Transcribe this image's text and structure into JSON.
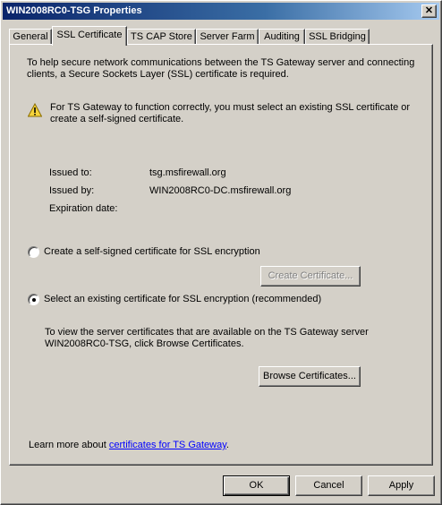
{
  "window": {
    "title": "WIN2008RC0-TSG Properties"
  },
  "tabs": [
    {
      "label": "General"
    },
    {
      "label": "SSL Certificate",
      "active": true
    },
    {
      "label": "TS CAP Store"
    },
    {
      "label": "Server Farm"
    },
    {
      "label": "Auditing"
    },
    {
      "label": "SSL Bridging"
    }
  ],
  "intro": {
    "line1": "To help secure network communications between the TS Gateway server and connecting",
    "line2": "clients, a Secure Sockets Layer (SSL) certificate is required."
  },
  "warning": {
    "icon": "warning-icon",
    "line1": "For TS Gateway to function correctly, you must select an existing SSL certificate or",
    "line2": "create a self-signed certificate."
  },
  "certificate": {
    "issued_to_label": "Issued to:",
    "issued_to_value": "tsg.msfirewall.org",
    "issued_by_label": "Issued by:",
    "issued_by_value": "WIN2008RC0-DC.msfirewall.org",
    "expiration_label": "Expiration date:",
    "expiration_value": ""
  },
  "options": {
    "self_signed_label": "Create a self-signed certificate for SSL encryption",
    "create_button": "Create Certificate...",
    "existing_label": "Select an existing certificate for SSL encryption (recommended)",
    "selected": "existing"
  },
  "browse": {
    "line1": "To view the server certificates that are available on the TS Gateway server",
    "line2": "WIN2008RC0-TSG, click Browse Certificates.",
    "button": "Browse Certificates..."
  },
  "learn_more": {
    "prefix": "Learn more about ",
    "link": "certificates for TS Gateway",
    "suffix": "."
  },
  "footer": {
    "ok": "OK",
    "cancel": "Cancel",
    "apply": "Apply"
  }
}
